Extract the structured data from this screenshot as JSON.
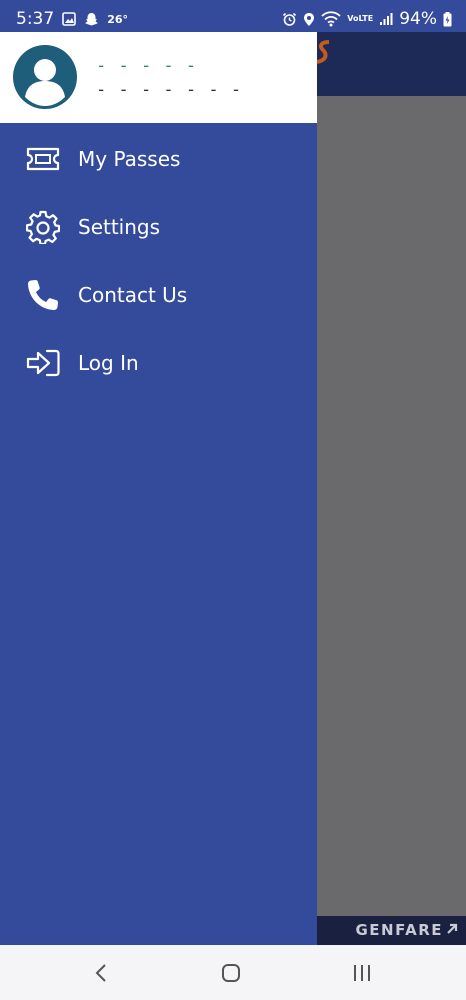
{
  "status_bar": {
    "time": "5:37",
    "temperature": "26°",
    "battery": "94%",
    "network_label": "VoLTE"
  },
  "background_app": {
    "footer_brand": "GENFARE"
  },
  "drawer": {
    "user": {
      "name": "- - - - -",
      "subtitle": "- - - - - - -"
    },
    "items": [
      {
        "label": "My Passes",
        "icon": "ticket-icon"
      },
      {
        "label": "Settings",
        "icon": "gear-icon"
      },
      {
        "label": "Contact Us",
        "icon": "phone-icon"
      },
      {
        "label": "Log In",
        "icon": "login-icon"
      }
    ]
  },
  "colors": {
    "drawer_bg": "#344b9c",
    "header_bg": "#ffffff",
    "avatar": "#1e5e7a",
    "username_green": "#2e8b57"
  }
}
